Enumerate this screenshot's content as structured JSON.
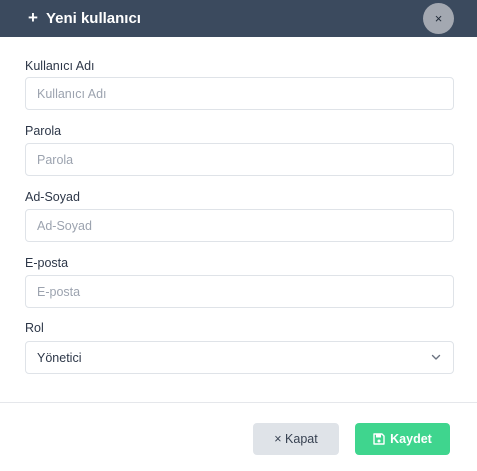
{
  "modal": {
    "title": "Yeni kullanıcı",
    "title_icon": "plus-icon",
    "close_icon": "close-icon",
    "close_symbol": "×"
  },
  "form": {
    "username": {
      "label": "Kullanıcı Adı",
      "placeholder": "Kullanıcı Adı",
      "value": ""
    },
    "password": {
      "label": "Parola",
      "placeholder": "Parola",
      "value": ""
    },
    "fullname": {
      "label": "Ad-Soyad",
      "placeholder": "Ad-Soyad",
      "value": ""
    },
    "email": {
      "label": "E-posta",
      "placeholder": "E-posta",
      "value": ""
    },
    "role": {
      "label": "Rol",
      "selected": "Yönetici"
    }
  },
  "footer": {
    "close_label": "× Kapat",
    "save_label": "Kaydet",
    "save_icon": "floppy-disk-icon"
  },
  "colors": {
    "header_bg": "#3b4a5e",
    "save_bg": "#3fd58e",
    "close_bg": "#dfe3e8"
  }
}
